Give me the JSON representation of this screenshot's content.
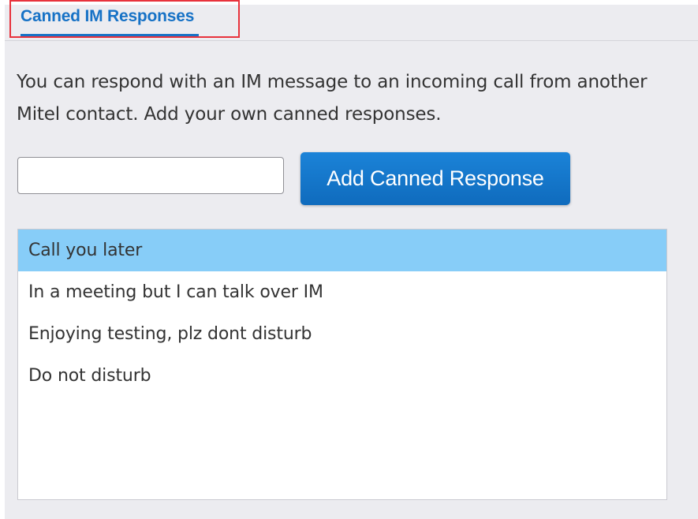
{
  "tabs": {
    "active_label": "Canned IM Responses"
  },
  "description": "You can respond with an IM message to an incoming call from another Mitel contact. Add your own canned responses.",
  "new_response_input": {
    "value": "",
    "placeholder": ""
  },
  "add_button_label": "Add Canned Response",
  "responses": [
    {
      "label": "Call you later",
      "selected": true
    },
    {
      "label": "In a meeting but I can talk over IM",
      "selected": false
    },
    {
      "label": "Enjoying testing, plz dont disturb",
      "selected": false
    },
    {
      "label": "Do not disturb",
      "selected": false
    }
  ],
  "colors": {
    "accent": "#1772c6",
    "button": "#1677c9",
    "selection": "#87cdf8",
    "annotation": "#e8323c",
    "panel_background": "#ececf0"
  }
}
